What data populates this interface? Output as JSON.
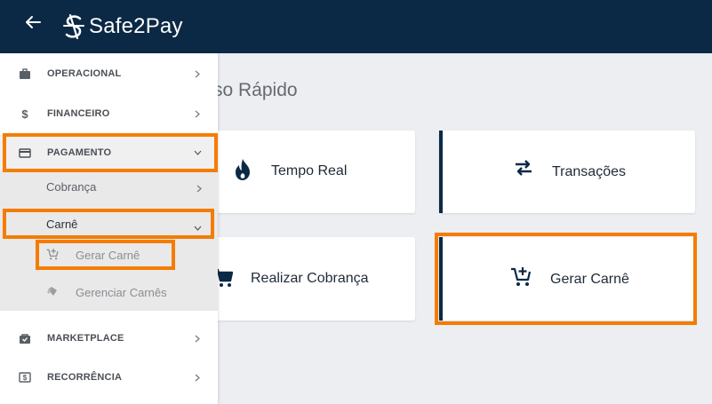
{
  "header": {
    "logo_text": "Safe2Pay",
    "back_icon": "arrow-left-icon"
  },
  "main": {
    "title": "Acesso Rápido",
    "title_visible": "so Rápido",
    "cards": [
      {
        "label": "Tempo Real",
        "icon": "flame-icon"
      },
      {
        "label": "Transações",
        "icon": "swap-arrows-icon"
      },
      {
        "label": "Realizar Cobrança",
        "icon": "cart-icon"
      },
      {
        "label": "Gerar Carnê",
        "icon": "cart-plus-icon"
      }
    ]
  },
  "sidebar": {
    "items": [
      {
        "label": "OPERACIONAL",
        "icon": "briefcase-icon"
      },
      {
        "label": "FINANCEIRO",
        "icon": "dollar-icon"
      },
      {
        "label": "PAGAMENTO",
        "icon": "credit-card-icon"
      },
      {
        "label": "MARKETPLACE",
        "icon": "shopping-bag-icon"
      },
      {
        "label": "RECORRÊNCIA",
        "icon": "money-icon"
      }
    ],
    "sub_items": [
      {
        "label": "Cobrança"
      },
      {
        "label": "Carnê"
      }
    ],
    "sub_sub_items": [
      {
        "label": "Gerar Carnê",
        "icon": "cart-plus-icon"
      },
      {
        "label": "Gerenciar Carnês",
        "icon": "tags-icon"
      }
    ]
  },
  "colors": {
    "header_bg": "#0b2945",
    "highlight": "#f57c00",
    "content_bg": "#eceef2",
    "accent": "#0b2945"
  }
}
